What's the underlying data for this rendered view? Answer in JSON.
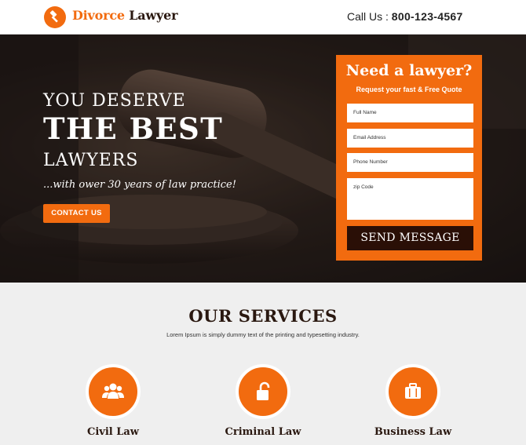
{
  "header": {
    "logo_word1": "Divorce",
    "logo_word2": "Lawyer",
    "call_label": "Call Us :",
    "phone": "800-123-4567",
    "logo_icon": "gavel-icon"
  },
  "hero": {
    "line1": "YOU DESERVE",
    "line2": "THE BEST",
    "line3": "LAWYERS",
    "tagline": "...with ower 30 years of law practice!",
    "contact_button": "CONTACT US"
  },
  "form": {
    "title": "Need a lawyer?",
    "subtitle": "Request your fast & Free Quote",
    "full_name_placeholder": "Full Name",
    "email_placeholder": "Email Address",
    "phone_placeholder": "Phone Number",
    "zip_placeholder": "zip Code",
    "submit_label": "SEND MESSAGE"
  },
  "services": {
    "title": "OUR SERVICES",
    "description": "Lorem Ipsum is simply dummy text of the printing and typesetting industry.",
    "items": [
      {
        "label": "Civil Law",
        "icon": "users-icon"
      },
      {
        "label": "Criminal Law",
        "icon": "unlock-icon"
      },
      {
        "label": "Business Law",
        "icon": "briefcase-icon"
      }
    ]
  },
  "colors": {
    "accent": "#f26b0f",
    "dark": "#2a1810",
    "services_bg": "#efefef"
  }
}
